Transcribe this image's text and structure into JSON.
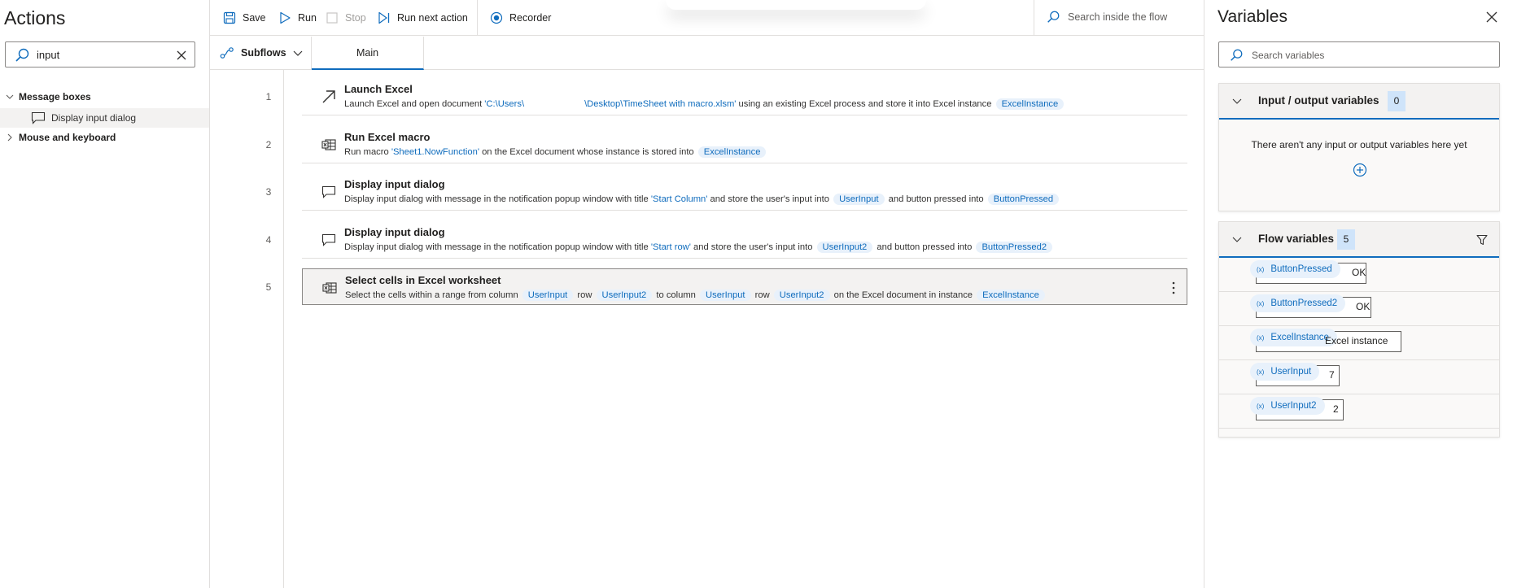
{
  "actions": {
    "title": "Actions",
    "search_value": "input",
    "groups": [
      {
        "label": "Message boxes",
        "items": [
          {
            "label": "Display input dialog"
          }
        ]
      },
      {
        "label": "Mouse and keyboard"
      }
    ]
  },
  "toolbar": {
    "save": "Save",
    "run": "Run",
    "stop": "Stop",
    "run_next": "Run next action",
    "recorder": "Recorder",
    "search": "Search inside the flow"
  },
  "tabs": {
    "subflows": "Subflows",
    "main": "Main"
  },
  "steps": [
    {
      "num": "1",
      "title": "Launch Excel"
    },
    {
      "num": "2",
      "title": "Run Excel macro"
    },
    {
      "num": "3",
      "title": "Display input dialog"
    },
    {
      "num": "4",
      "title": "Display input dialog"
    },
    {
      "num": "5",
      "title": "Select cells in Excel worksheet"
    }
  ],
  "step_desc": {
    "s1": {
      "t1": "Launch Excel and open document ",
      "path1": "'C:\\Users\\",
      "path2": "\\Desktop\\TimeSheet with macro.xlsm'",
      "t2": " using an existing Excel process and store it into Excel instance ",
      "v1": "ExcelInstance"
    },
    "s2": {
      "t1": "Run macro ",
      "s1": "'Sheet1.NowFunction'",
      "t2": " on the Excel document whose instance is stored into ",
      "v1": "ExcelInstance"
    },
    "s3": {
      "t1": "Display input dialog with message  in the notification popup window with title ",
      "s1": "'Start Column'",
      "t2": " and store the user's input into ",
      "v1": "UserInput",
      "t3": " and button pressed into ",
      "v2": "ButtonPressed"
    },
    "s4": {
      "t1": "Display input dialog with message  in the notification popup window with title ",
      "s1": "'Start row'",
      "t2": " and store the user's input into ",
      "v1": "UserInput2",
      "t3": " and button pressed into ",
      "v2": "ButtonPressed2"
    },
    "s5": {
      "t1": "Select the cells within a range from column ",
      "v1": "UserInput",
      "t2": " row ",
      "v2": "UserInput2",
      "t3": " to column ",
      "v3": "UserInput",
      "t4": " row ",
      "v4": "UserInput2",
      "t5": " on the Excel document in instance ",
      "v5": "ExcelInstance"
    }
  },
  "variables": {
    "title": "Variables",
    "search_placeholder": "Search variables",
    "io": {
      "title": "Input / output variables",
      "count": "0",
      "empty": "There aren't any input or output variables here yet"
    },
    "flow": {
      "title": "Flow variables",
      "count": "5",
      "items": [
        {
          "name": "ButtonPressed",
          "value": "OK"
        },
        {
          "name": "ButtonPressed2",
          "value": "OK"
        },
        {
          "name": "ExcelInstance",
          "value": "Excel instance"
        },
        {
          "name": "UserInput",
          "value": "7"
        },
        {
          "name": "UserInput2",
          "value": "2"
        }
      ]
    },
    "var_glyph": "(x)"
  },
  "colors": {
    "accent": "#0f6cbd",
    "variable_bg": "#e8f1fb",
    "count_bg": "#cfe4fa",
    "selected_bg": "#f3f2f1"
  }
}
